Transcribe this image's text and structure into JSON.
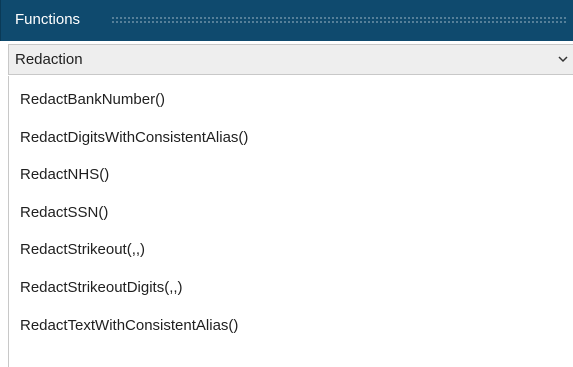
{
  "panel": {
    "title": "Functions"
  },
  "dropdown": {
    "selected": "Redaction",
    "icon": "chevron-down-icon"
  },
  "functions": [
    "RedactBankNumber()",
    "RedactDigitsWithConsistentAlias()",
    "RedactNHS()",
    "RedactSSN()",
    "RedactStrikeout(,,)",
    "RedactStrikeoutDigits(,,)",
    "RedactTextWithConsistentAlias()"
  ],
  "colors": {
    "header_bg": "#0f4a6e",
    "header_text": "#ffffff",
    "dropdown_bg": "#eeeeee",
    "text": "#1f1f1f"
  }
}
